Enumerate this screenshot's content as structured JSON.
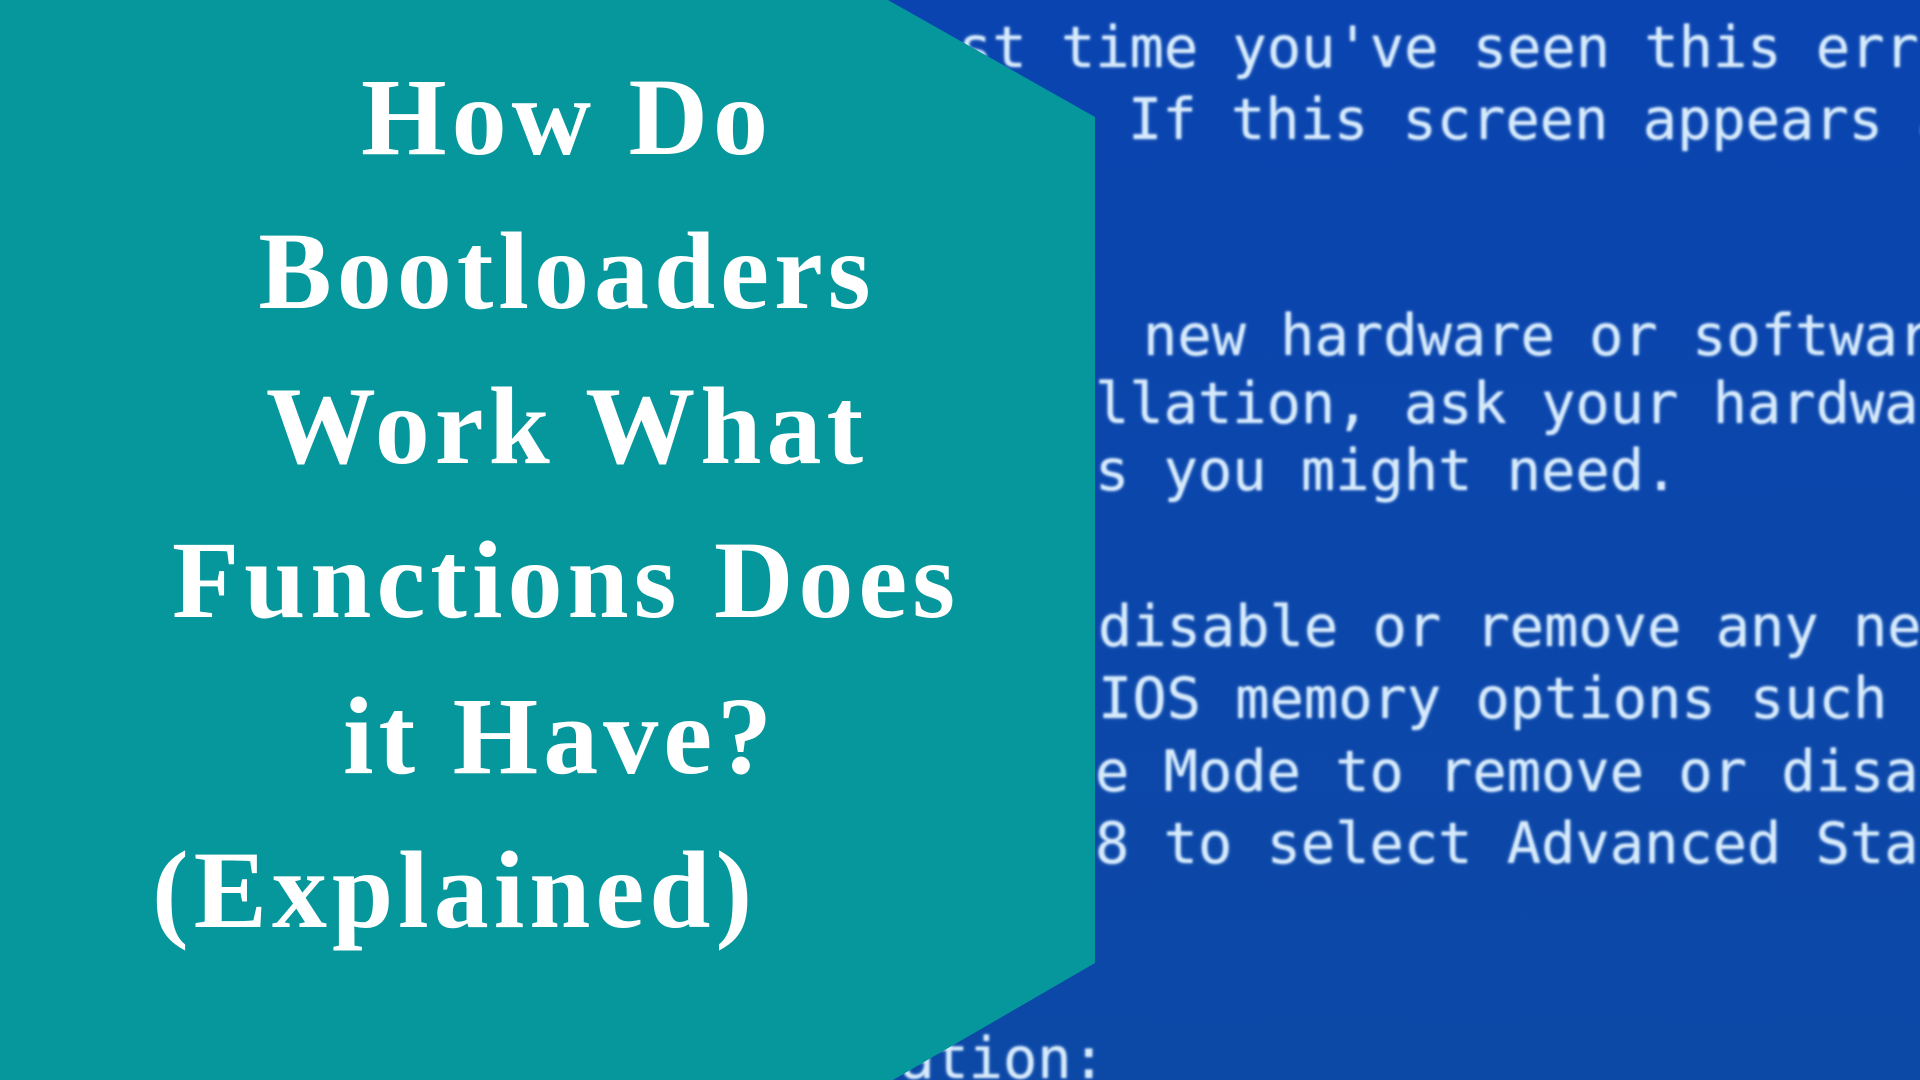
{
  "colors": {
    "panel_teal": "#05979b",
    "bsod_blue": "#0a45ac",
    "bsod_text": "#d6eafb",
    "title_text": "#ffffff"
  },
  "title": {
    "lines": [
      "How Do",
      "Bootloaders",
      "Work What",
      "Functions Does",
      "it Have?",
      "(Explained)"
    ]
  },
  "background_screen": {
    "description": "Blue screen error message (partially covered)",
    "lines": [
      "st time you've seen this err",
      "If this screen appears a",
      "new hardware or software",
      "llation, ask your hardwa",
      "s you might need.",
      "disable or remove any new",
      "IOS memory options such a",
      "e Mode to remove or disab",
      "8 to select Advanced Sta",
      "ation:"
    ]
  }
}
